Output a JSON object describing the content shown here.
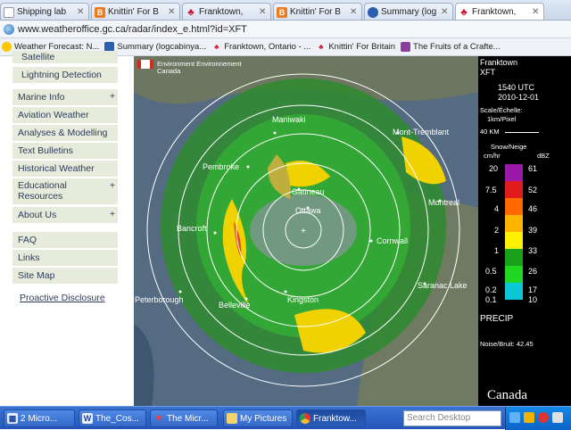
{
  "tabs": [
    {
      "label": "Shipping lab",
      "icon": "blank-page"
    },
    {
      "label": "Knittin' For B",
      "icon": "blogger"
    },
    {
      "label": "Franktown,",
      "icon": "maple-leaf"
    },
    {
      "label": "Knittin' For B",
      "icon": "blogger"
    },
    {
      "label": "Summary (log",
      "icon": "summary"
    },
    {
      "label": "Franktown,",
      "icon": "maple-leaf"
    }
  ],
  "address": {
    "url": "www.weatheroffice.gc.ca/radar/index_e.html?id=XFT"
  },
  "bookmarks": [
    {
      "label": "Weather Forecast: N...",
      "icon": "weather"
    },
    {
      "label": "Summary (logcabinya...",
      "icon": "summary"
    },
    {
      "label": "Franktown, Ontario - ...",
      "icon": "maple-leaf"
    },
    {
      "label": "Knittin' For Britain",
      "icon": "blogger"
    },
    {
      "label": "The Fruits of a Crafte...",
      "icon": "fruit"
    }
  ],
  "sidebar": {
    "items": [
      {
        "label": "Satellite",
        "plus": ""
      },
      {
        "label": "Lightning Detection",
        "plus": ""
      },
      {
        "label": "Marine Info",
        "plus": "+"
      },
      {
        "label": "Aviation Weather",
        "plus": ""
      },
      {
        "label": "Analyses & Modelling",
        "plus": ""
      },
      {
        "label": "Text Bulletins",
        "plus": ""
      },
      {
        "label": "Historical Weather",
        "plus": ""
      },
      {
        "label": "Educational Resources",
        "plus": "+"
      },
      {
        "label": "About Us",
        "plus": "+"
      },
      {
        "label": "FAQ",
        "plus": ""
      },
      {
        "label": "Links",
        "plus": ""
      },
      {
        "label": "Site Map",
        "plus": ""
      }
    ],
    "proactive": "Proactive Disclosure"
  },
  "radar": {
    "agency": "Environment Environnement",
    "agency2": "Canada",
    "cities": [
      {
        "name": "Maniwaki"
      },
      {
        "name": "Mont-Tremblant"
      },
      {
        "name": "Pembroke"
      },
      {
        "name": "Gatineau"
      },
      {
        "name": "Ottawa"
      },
      {
        "name": "Montreal"
      },
      {
        "name": "Bancroft"
      },
      {
        "name": "Cornwall"
      },
      {
        "name": "Kingston"
      },
      {
        "name": "Belleville"
      },
      {
        "name": "Peterborough"
      },
      {
        "name": "Saranac Lake"
      }
    ]
  },
  "legend": {
    "station": "Franktown",
    "station_id": "XFT",
    "time": "1540  UTC",
    "date": "2010-12-01",
    "scale_label": "Scale/Échelle:",
    "scale_value": "1km/Pixel",
    "distance": "40 KM",
    "snow_label": "Snow/Neige",
    "unit_cm": "cm/hr",
    "unit_dbz": "dBZ",
    "rates": [
      "20",
      "7.5",
      "4",
      "2",
      "1",
      "0.5",
      "0.2",
      "0.1"
    ],
    "dbz": [
      "61",
      "52",
      "46",
      "39",
      "33",
      "26",
      "17",
      "10"
    ],
    "colors": [
      "#9b19a9",
      "#e11b1b",
      "#ff6a00",
      "#ffb400",
      "#fff200",
      "#1aa01a",
      "#22d622",
      "#0ac8d8"
    ],
    "precip": "PRECIP",
    "noise": "Noise/Bruit: 42.45",
    "wordmark": "Canada"
  },
  "taskbar": {
    "buttons": [
      {
        "label": "2 Micro...",
        "icon": "windows"
      },
      {
        "label": "The_Cos...",
        "icon": "word"
      },
      {
        "label": "The Micr...",
        "icon": "heart"
      },
      {
        "label": "My Pictures",
        "icon": "folder"
      },
      {
        "label": "Franktow...",
        "icon": "chrome"
      }
    ],
    "search_placeholder": "Search Desktop"
  }
}
